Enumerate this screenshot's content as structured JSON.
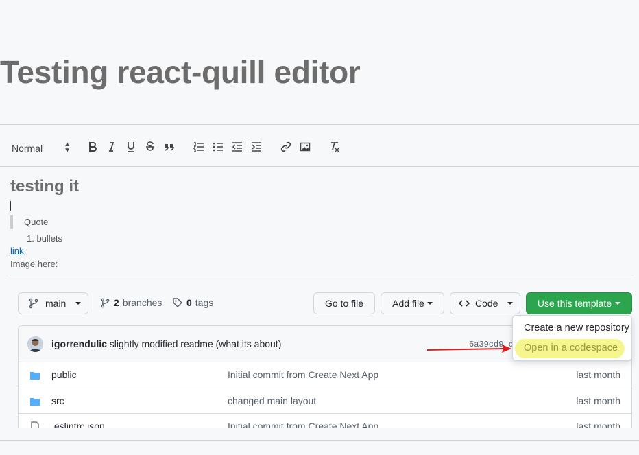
{
  "page": {
    "title": "Testing react-quill editor"
  },
  "toolbar": {
    "format_value": "Normal",
    "buttons": [
      "bold-icon",
      "italic-icon",
      "underline-icon",
      "strike-icon",
      "blockquote-icon",
      "ordered-list-icon",
      "bullet-list-icon",
      "outdent-icon",
      "indent-icon",
      "link-icon",
      "image-icon",
      "clean-format-icon"
    ]
  },
  "editor": {
    "heading": "testing it",
    "quote": "Quote",
    "list_item": "1. bullets",
    "link": "link",
    "image_label": "Image here:"
  },
  "repo": {
    "branch": "main",
    "branches_count": "2",
    "branches_label": "branches",
    "tags_count": "0",
    "tags_label": "tags",
    "go_to_file": "Go to file",
    "add_file": "Add file",
    "code": "Code",
    "use_template": "Use this template",
    "commit": {
      "author": "igorrendulic",
      "message": "slightly modified readme (what its about)",
      "sha": "6a39cd9 c"
    },
    "files": [
      {
        "name": "public",
        "type": "folder",
        "message": "Initial commit from Create Next App",
        "age": "last month"
      },
      {
        "name": "src",
        "type": "folder",
        "message": "changed main layout",
        "age": "last month"
      },
      {
        "name": ".eslintrc.json",
        "type": "file",
        "message": "Initial commit from Create Next App",
        "age": "last month"
      }
    ]
  },
  "template_menu": {
    "items": [
      "Create a new repository",
      "Open in a codespace"
    ]
  },
  "colors": {
    "accent_green": "#2da44e",
    "folder_blue": "#54aeff",
    "highlight_yellow": "#f5f57a",
    "arrow_red": "#e02020"
  }
}
